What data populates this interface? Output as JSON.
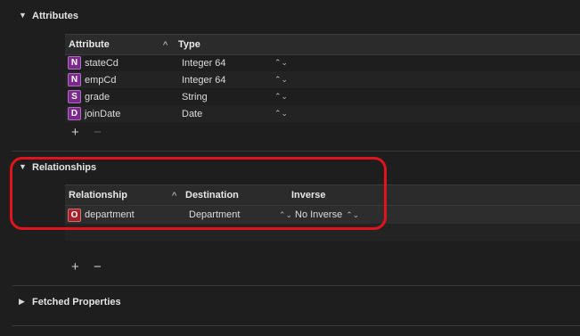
{
  "attributes": {
    "section_title": "Attributes",
    "col_attribute": "Attribute",
    "col_type": "Type",
    "sort_glyph": "^",
    "rows": [
      {
        "badge": "N",
        "name": "stateCd",
        "type": "Integer 64"
      },
      {
        "badge": "N",
        "name": "empCd",
        "type": "Integer 64"
      },
      {
        "badge": "S",
        "name": "grade",
        "type": "String"
      },
      {
        "badge": "D",
        "name": "joinDate",
        "type": "Date"
      }
    ]
  },
  "relationships": {
    "section_title": "Relationships",
    "col_relationship": "Relationship",
    "col_destination": "Destination",
    "col_inverse": "Inverse",
    "sort_glyph": "^",
    "rows": [
      {
        "badge": "O",
        "name": "department",
        "destination": "Department",
        "inverse": "No Inverse"
      }
    ]
  },
  "fetched": {
    "section_title": "Fetched Properties"
  },
  "buttons": {
    "add": "+",
    "remove": "−"
  },
  "colors": {
    "highlight": "#e0141c",
    "attribute_badge": "#7a2a8a",
    "relationship_badge": "#a4212a"
  },
  "icons": {
    "expanded": "disclosure-triangle-down",
    "collapsed": "disclosure-triangle-right",
    "stepper": "up-down-chevron"
  }
}
